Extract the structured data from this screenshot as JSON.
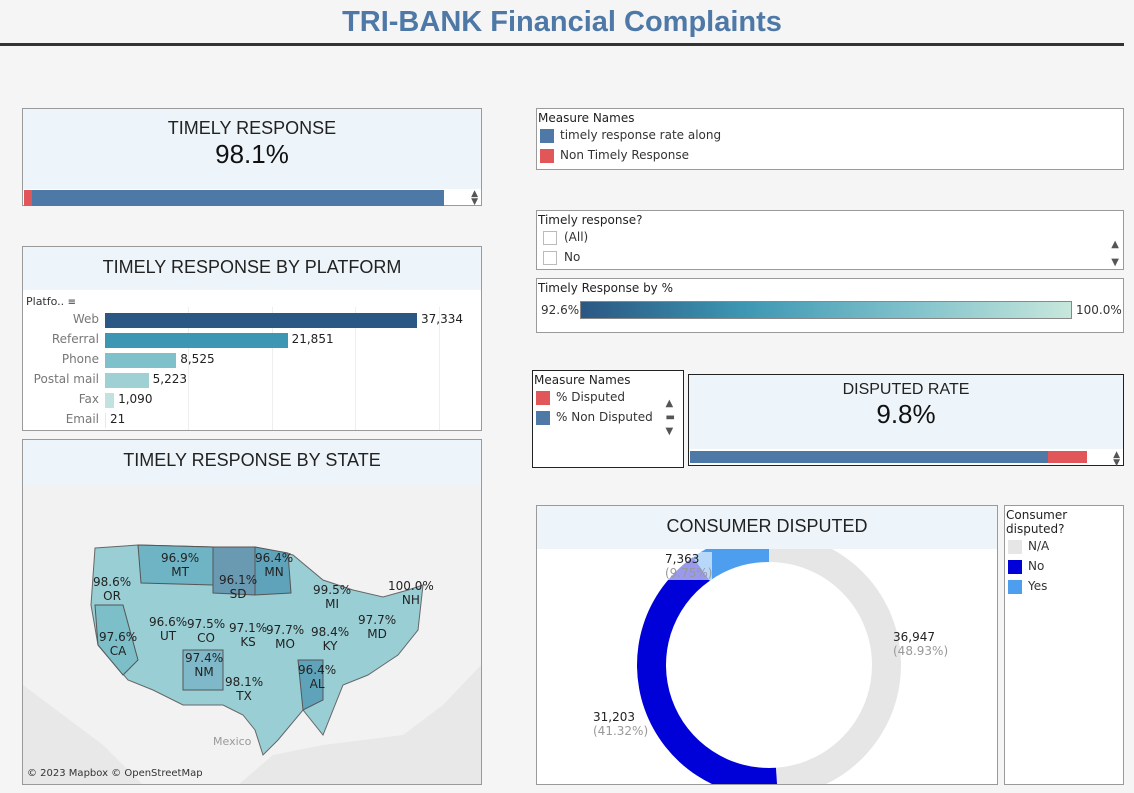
{
  "title": "TRI-BANK Financial Complaints",
  "timely_kpi": {
    "title": "TIMELY RESPONSE",
    "value": "98.1%",
    "fraction": 0.981
  },
  "legend_measure1": {
    "title": "Measure Names",
    "items": [
      {
        "label": "timely response rate along",
        "color": "#4e79a7"
      },
      {
        "label": "Non Timely Response",
        "color": "#e15759"
      }
    ]
  },
  "timely_filter": {
    "title": "Timely response?",
    "options": [
      "(All)",
      "No"
    ]
  },
  "gradient": {
    "title": "Timely Response by %",
    "min": "92.6%",
    "max": "100.0%"
  },
  "platform": {
    "title": "TIMELY RESPONSE BY PLATFORM",
    "header": "Platfo..",
    "chart_data": {
      "type": "bar",
      "categories": [
        "Web",
        "Referral",
        "Phone",
        "Postal mail",
        "Fax",
        "Email"
      ],
      "values": [
        37334,
        21851,
        8525,
        5223,
        1090,
        21
      ],
      "labels": [
        "37,334",
        "21,851",
        "8,525",
        "5,223",
        "1,090",
        "21"
      ],
      "colors": [
        "#2a5783",
        "#3d97b3",
        "#7fc1cb",
        "#9ed0d4",
        "#c2e2e0",
        "#d8eeec"
      ]
    }
  },
  "state": {
    "title": "TIMELY RESPONSE BY STATE",
    "credit": "© 2023 Mapbox © OpenStreetMap",
    "country_label": "Mexico",
    "labels": [
      {
        "pct": "96.9%",
        "abbr": "MT"
      },
      {
        "pct": "96.4%",
        "abbr": "MN"
      },
      {
        "pct": "98.6%",
        "abbr": "OR"
      },
      {
        "pct": "96.1%",
        "abbr": "SD"
      },
      {
        "pct": "99.5%",
        "abbr": "MI"
      },
      {
        "pct": "100.0%",
        "abbr": "NH"
      },
      {
        "pct": "97.7%",
        "abbr": "MD"
      },
      {
        "pct": "97.6%",
        "abbr": "CA"
      },
      {
        "pct": "96.6%",
        "abbr": "UT"
      },
      {
        "pct": "97.5%",
        "abbr": "CO"
      },
      {
        "pct": "97.1%",
        "abbr": "KS"
      },
      {
        "pct": "97.7%",
        "abbr": "MO"
      },
      {
        "pct": "98.4%",
        "abbr": "KY"
      },
      {
        "pct": "97.4%",
        "abbr": "NM"
      },
      {
        "pct": "96.4%",
        "abbr": "AL"
      },
      {
        "pct": "98.1%",
        "abbr": "TX"
      }
    ]
  },
  "legend_measure2": {
    "title": "Measure Names",
    "items": [
      {
        "label": "% Disputed",
        "color": "#e15759"
      },
      {
        "label": "% Non Disputed",
        "color": "#4e79a7"
      }
    ]
  },
  "disputed_kpi": {
    "title": "DISPUTED RATE",
    "value": "9.8%",
    "fraction": 0.098
  },
  "consumer": {
    "title": "CONSUMER DISPUTED",
    "chart_data": {
      "type": "pie",
      "slices": [
        {
          "name": "N/A",
          "value": 36947,
          "label": "36,947",
          "pct": "(48.93%)",
          "color": "#e6e6e6"
        },
        {
          "name": "No",
          "value": 31203,
          "label": "31,203",
          "pct": "(41.32%)",
          "color": "#0000d8"
        },
        {
          "name": "Yes",
          "value": 7363,
          "label": "7,363",
          "pct": "(9.75%)",
          "color": "#4e9ef0"
        }
      ]
    }
  },
  "consumer_legend": {
    "title": "Consumer disputed?",
    "items": [
      {
        "label": "N/A",
        "color": "#e6e6e6"
      },
      {
        "label": "No",
        "color": "#0000d8"
      },
      {
        "label": "Yes",
        "color": "#4e9ef0"
      }
    ]
  }
}
